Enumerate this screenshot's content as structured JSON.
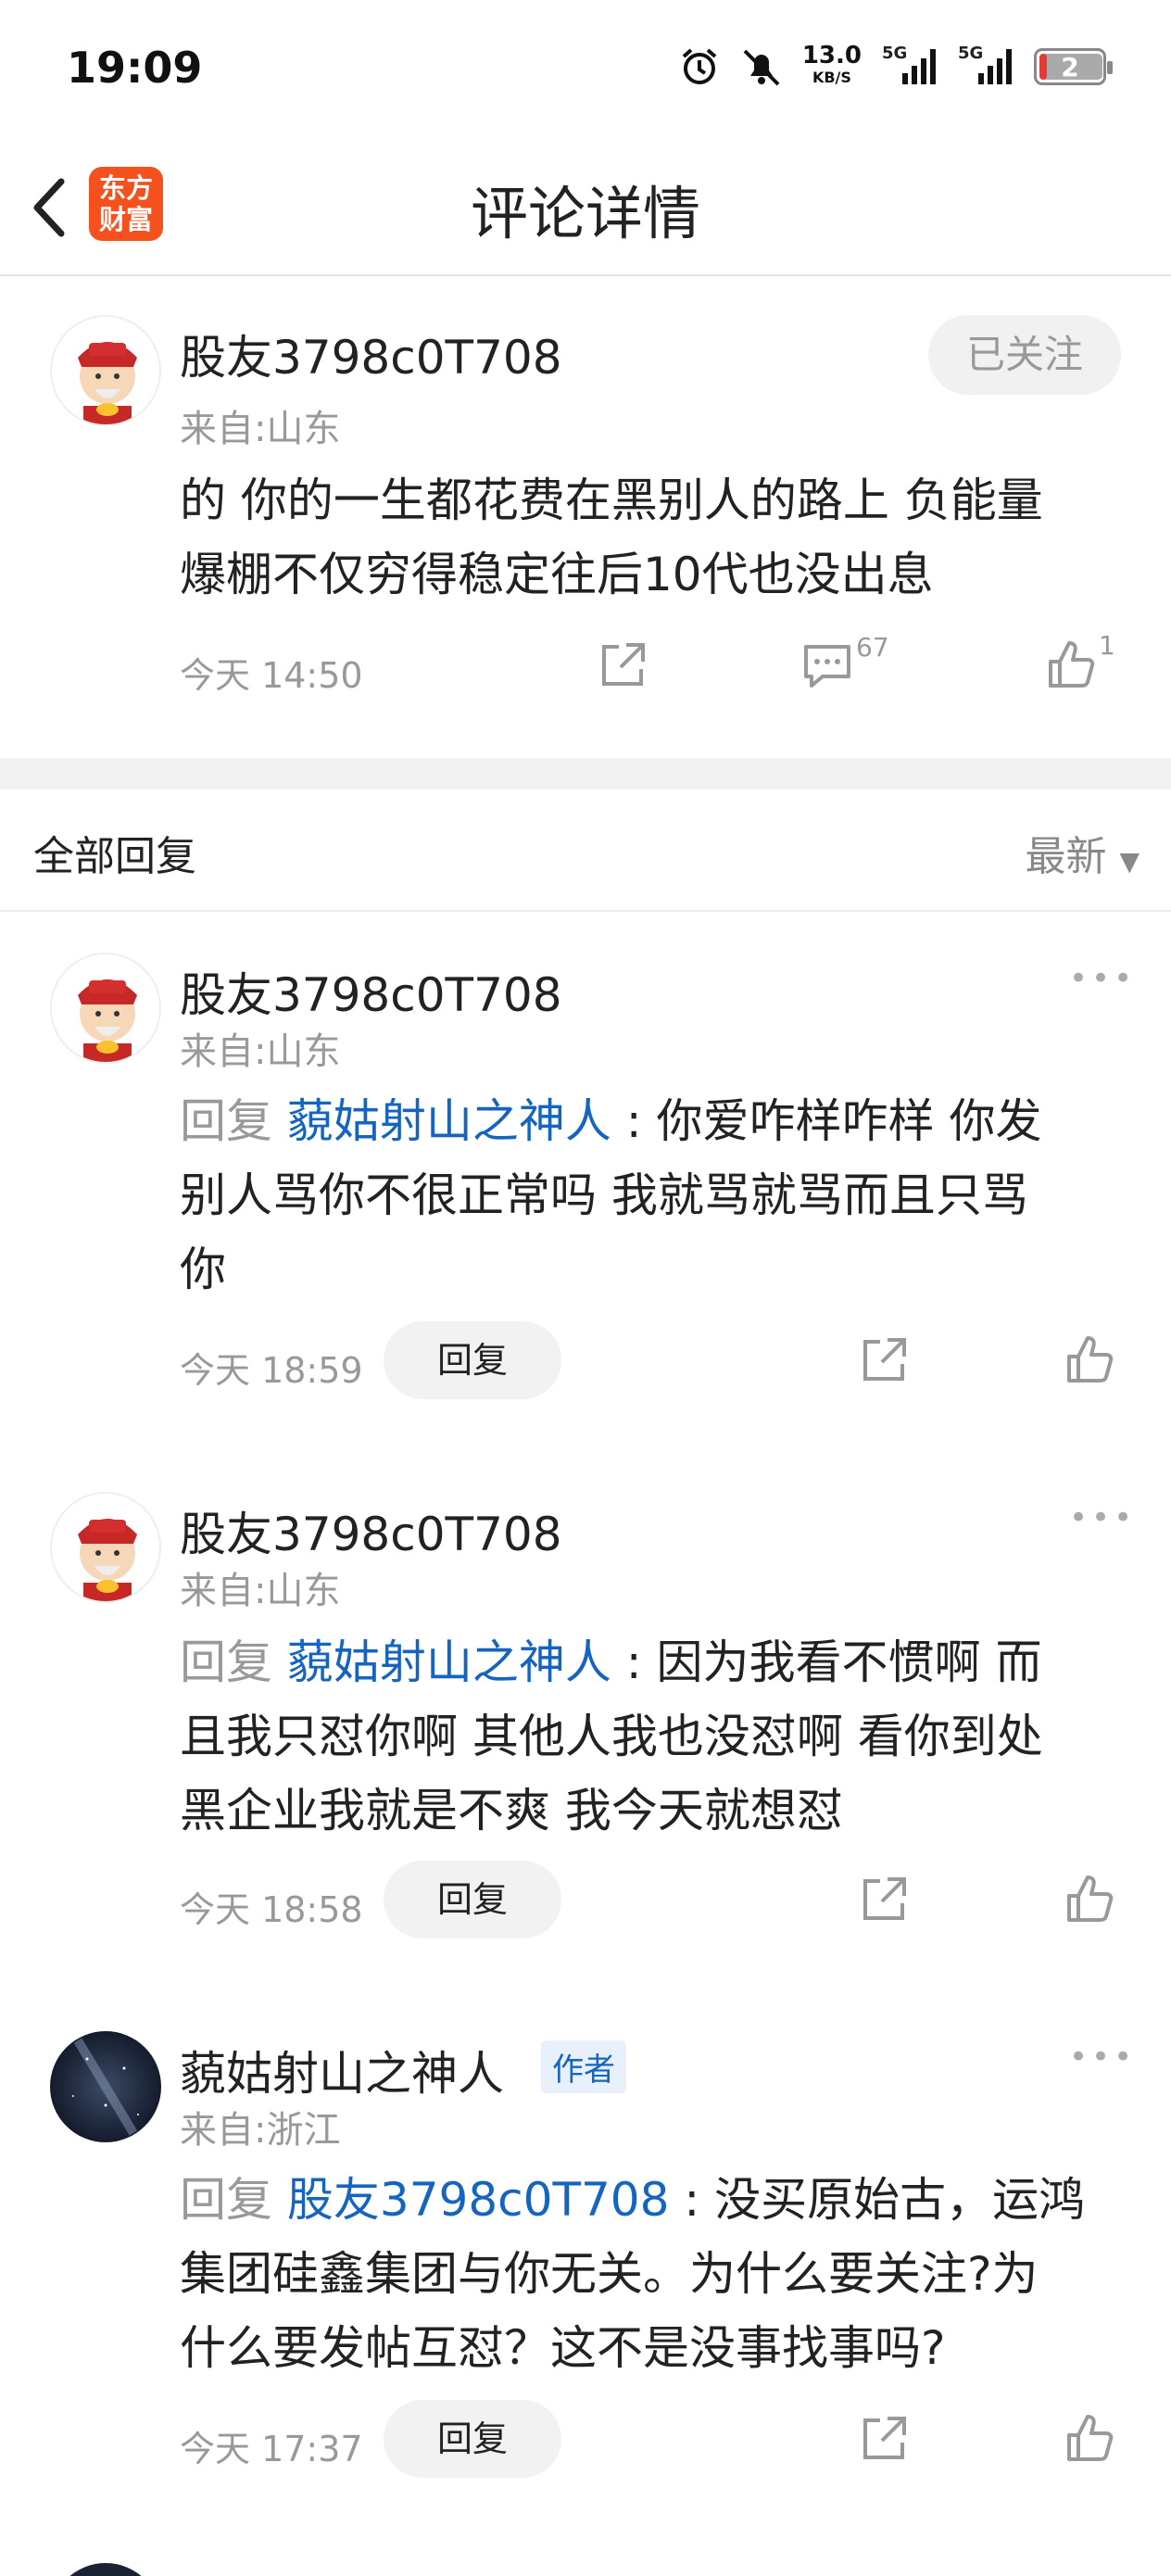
{
  "status_bar": {
    "time": "19:09",
    "speed_value": "13.0",
    "speed_unit": "KB/S",
    "net1": "5G",
    "net2": "5G",
    "battery": "2"
  },
  "nav": {
    "logo_line1": "东方",
    "logo_line2": "财富",
    "title": "评论详情"
  },
  "main_comment": {
    "username": "股友3798c0T708",
    "location": "来自:山东",
    "follow_label": "已关注",
    "line1": "的 你的一生都花费在黑别人的路上 负能量",
    "line2": "爆棚不仅穷得稳定往后10代也没出息",
    "time": "今天 14:50",
    "comment_count": "67",
    "like_count": "1"
  },
  "replies_header": {
    "title": "全部回复",
    "sort": "最新"
  },
  "replies": [
    {
      "username": "股友3798c0T708",
      "location": "来自:山东",
      "prefix": "回复",
      "target": "藐姑射山之神人",
      "line1": "你爱咋样咋样 你发",
      "line2": "别人骂你不很正常吗 我就骂就骂而且只骂",
      "line3": "你",
      "time": "今天 18:59",
      "reply_label": "回复"
    },
    {
      "username": "股友3798c0T708",
      "location": "来自:山东",
      "prefix": "回复",
      "target": "藐姑射山之神人",
      "line1": "因为我看不惯啊 而",
      "line2": "且我只怼你啊 其他人我也没怼啊  看你到处",
      "line3": "黑企业我就是不爽 我今天就想怼",
      "time": "今天 18:58",
      "reply_label": "回复"
    },
    {
      "username": "藐姑射山之神人",
      "author_tag": "作者",
      "location": "来自:浙江",
      "prefix": "回复",
      "target": "股友3798c0T708",
      "line1": "没买原始古，运鸿",
      "line2": "集团硅鑫集团与你无关。为什么要关注?为",
      "line3": "什么要发帖互怼？这不是没事找事吗?",
      "time": "今天 17:37",
      "reply_label": "回复"
    }
  ]
}
